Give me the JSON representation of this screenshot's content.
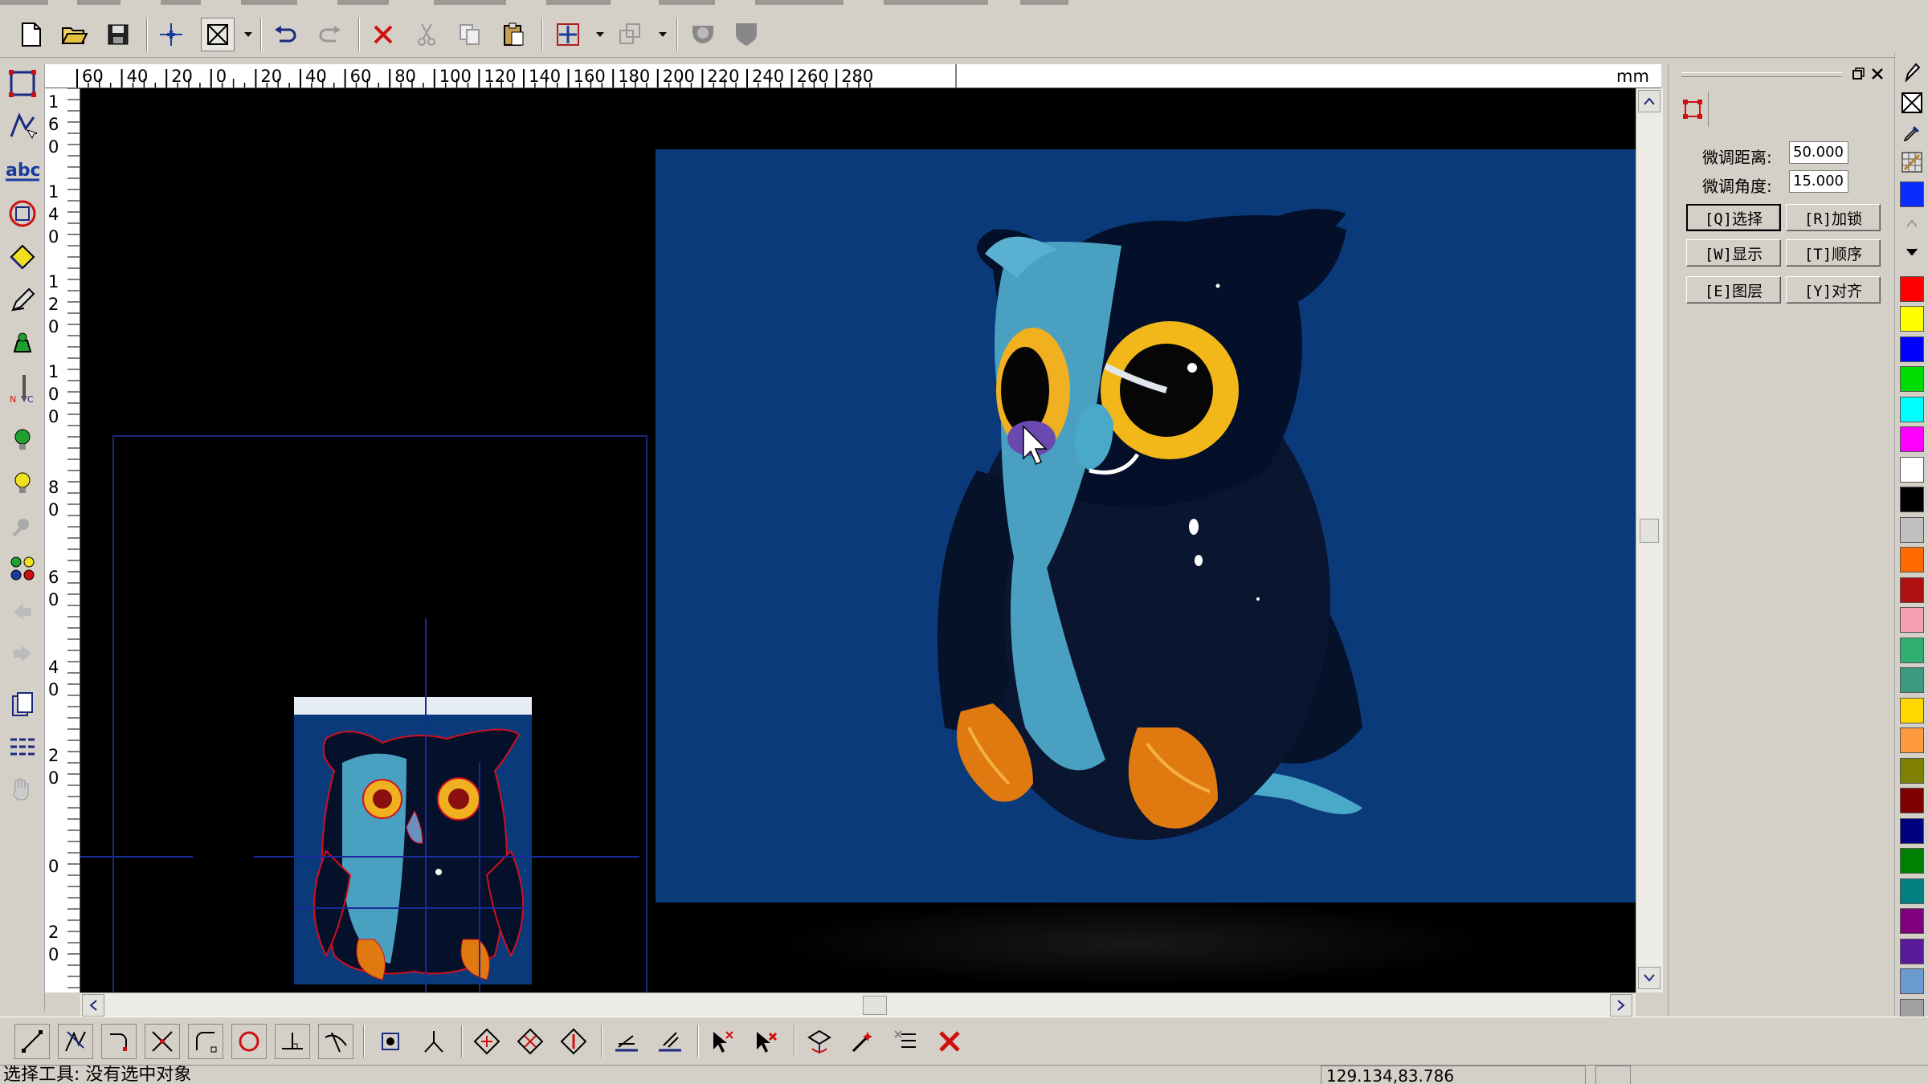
{
  "ruler": {
    "unit": "mm",
    "top_labels": [
      "60",
      "40",
      "20",
      "0",
      "20",
      "40",
      "60",
      "80",
      "100",
      "120",
      "140",
      "160",
      "180",
      "200",
      "220",
      "240",
      "260",
      "280"
    ],
    "left_labels": [
      "1",
      "6",
      "0",
      "1",
      "4",
      "0",
      "1",
      "2",
      "0",
      "1",
      "0",
      "0",
      "8",
      "0",
      "6",
      "0",
      "4",
      "0",
      "2",
      "0",
      "0",
      "2",
      "0"
    ]
  },
  "properties_panel": {
    "nudge_distance_label": "微调距离:",
    "nudge_distance_value": "50.000",
    "nudge_angle_label": "微调角度:",
    "nudge_angle_value": "15.000",
    "buttons": [
      {
        "label": "[Q]选择",
        "active": true
      },
      {
        "label": "[R]加锁",
        "active": false
      },
      {
        "label": "[W]显示",
        "active": false
      },
      {
        "label": "[T]顺序",
        "active": false
      },
      {
        "label": "[E]图层",
        "active": false
      },
      {
        "label": "[Y]对齐",
        "active": false
      }
    ]
  },
  "palette": {
    "colors": [
      "#0a2cff",
      "#ff0000",
      "#ffff00",
      "#0000ff",
      "#00dd00",
      "#00ffff",
      "#ff00ff",
      "#ffffff",
      "#000000",
      "#c0c0c0",
      "#ff6a00",
      "#b01010",
      "#f4a0b0",
      "#30b070",
      "#3c9a80",
      "#ffd800",
      "#ff9a40",
      "#808000",
      "#800000",
      "#000080",
      "#008000",
      "#008080",
      "#800080",
      "#5a1a9a",
      "#6a9ad0",
      "#a0a0a0"
    ]
  },
  "status": {
    "message": "选择工具: 没有选中对象",
    "coordinates": "129.134,83.786"
  }
}
